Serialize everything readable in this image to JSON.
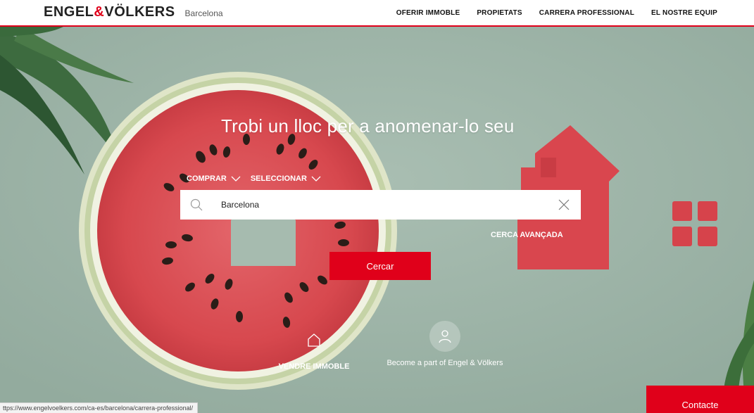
{
  "header": {
    "brand_part1": "ENGEL",
    "brand_amp": "&",
    "brand_part2": "VÖLKERS",
    "city": "Barcelona",
    "nav": [
      "OFERIR IMMOBLE",
      "PROPIETATS",
      "CARRERA PROFESSIONAL",
      "EL NOSTRE EQUIP"
    ]
  },
  "hero": {
    "headline": "Trobi un lloc per a anomenar-lo seu",
    "filters": {
      "transaction": "COMPRAR",
      "type": "SELECCIONAR"
    },
    "search": {
      "value": "Barcelona",
      "placeholder": ""
    },
    "advanced_label": "CERCA AVANÇADA",
    "search_button": "Cercar",
    "actions": {
      "sell": "VENDRE IMMOBLE",
      "join": "Become a part of Engel & Völkers"
    },
    "contact_button": "Contacte"
  },
  "status_bar": {
    "url": "ttps://www.engelvoelkers.com/ca-es/barcelona/carrera-professional/"
  },
  "colors": {
    "accent": "#e0001a",
    "background": "#9fb6aa",
    "melon_flesh": "#d94a4f",
    "rind": "#e9ecd6"
  },
  "icons": {
    "search": "magnifier-icon",
    "clear": "close-icon",
    "sell": "house-icon",
    "join": "person-icon",
    "filter_dropdown": "chevron-down-icon"
  }
}
